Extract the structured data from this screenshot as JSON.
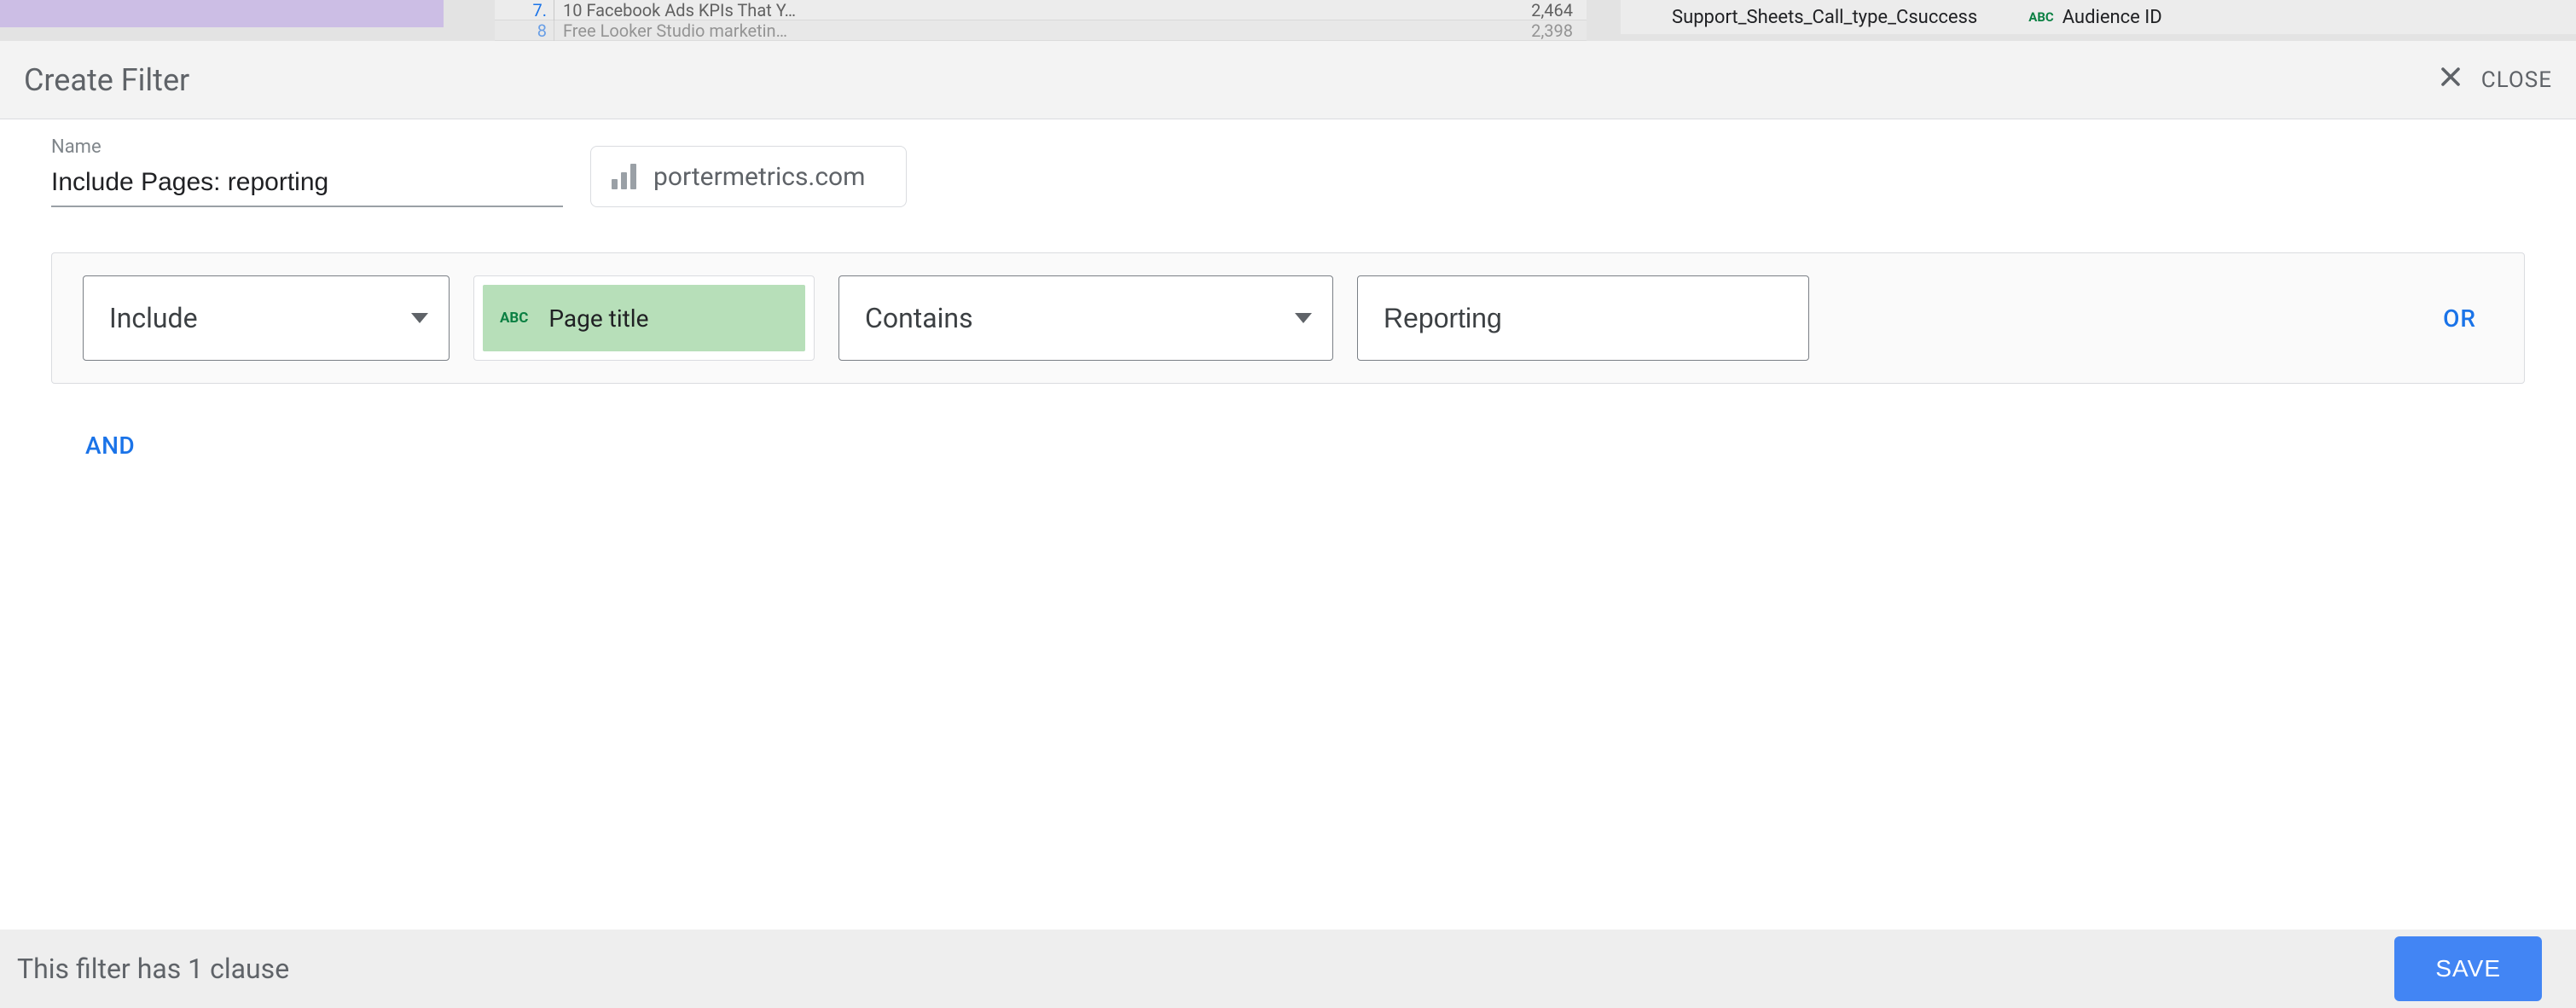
{
  "background": {
    "table_rows": [
      {
        "index": "7.",
        "title": "10 Facebook Ads KPIs That Y…",
        "value": "2,464"
      },
      {
        "index": "8",
        "title": "Free Looker Studio marketin…",
        "value": "2,398"
      }
    ],
    "right_panel": {
      "report_label": "Support_Sheets_Call_type_Csuccess",
      "field_label": "Audience ID"
    }
  },
  "header": {
    "title": "Create Filter",
    "close_label": "CLOSE"
  },
  "name_field": {
    "label": "Name",
    "value": "Include Pages: reporting"
  },
  "data_source": {
    "label": "portermetrics.com"
  },
  "clause": {
    "include_label": "Include",
    "field_label": "Page title",
    "condition_label": "Contains",
    "value": "Reporting",
    "or_label": "OR",
    "and_label": "AND"
  },
  "footer": {
    "status": "This filter has 1 clause",
    "save_label": "SAVE"
  }
}
